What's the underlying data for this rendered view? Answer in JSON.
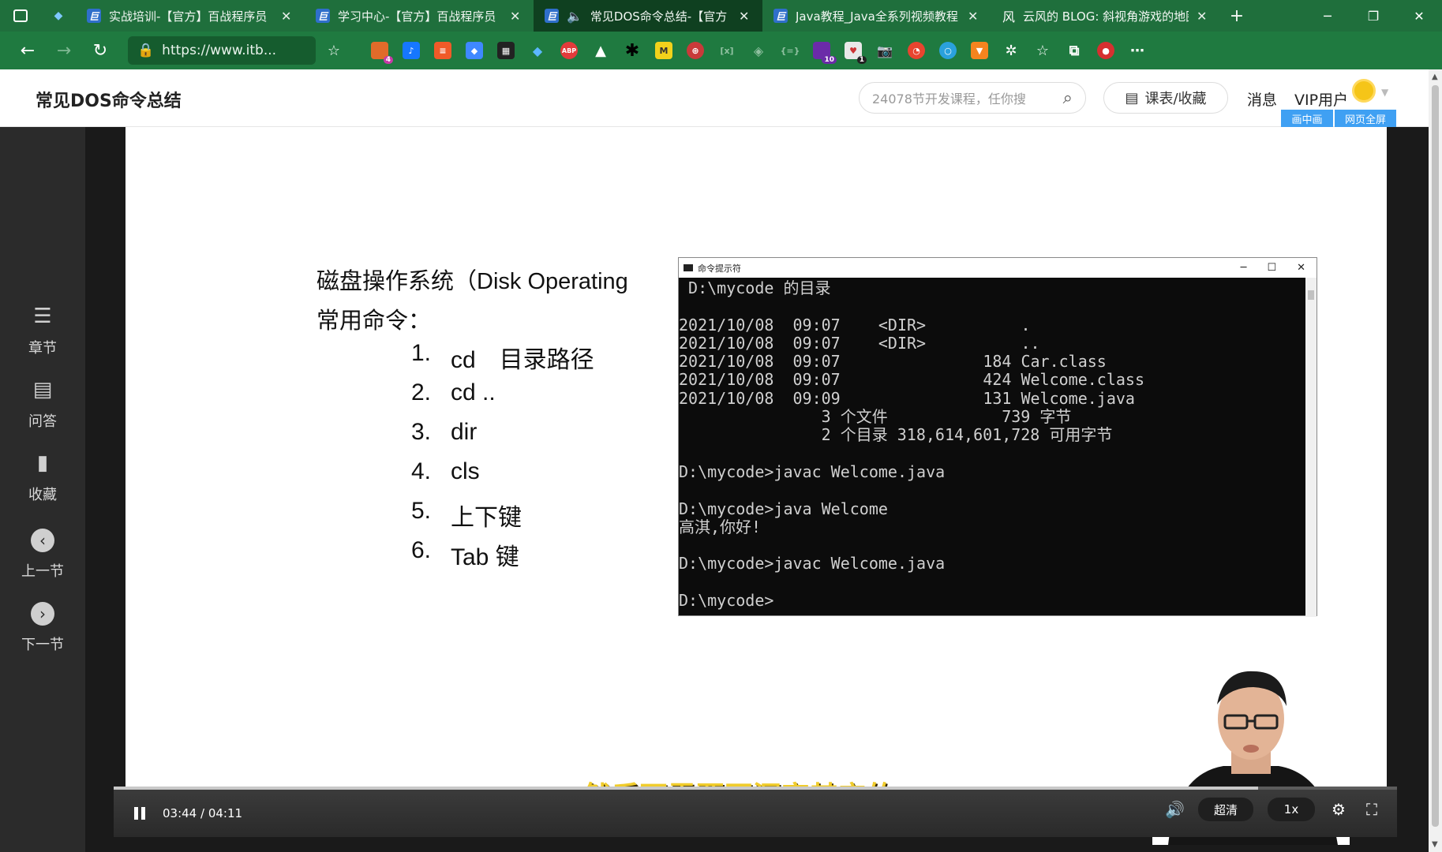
{
  "browser": {
    "tabs": [
      {
        "title": "实战培训-【官方】百战程序员",
        "active": false
      },
      {
        "title": "学习中心-【官方】百战程序员",
        "active": false
      },
      {
        "title": "常见DOS命令总结-【官方",
        "active": true,
        "audio": true
      },
      {
        "title": "Java教程_Java全系列视频教程",
        "active": false
      },
      {
        "title": "云风的 BLOG: 斜视角游戏的地图",
        "active": false
      }
    ],
    "url": "https://www.itb...",
    "extension_badges": {
      "ext1": "4",
      "ext2": "10",
      "ext3": "1"
    },
    "ext_labels": {
      "abp": "ABP",
      "m": "M"
    }
  },
  "header": {
    "title": "常见DOS命令总结",
    "search_placeholder": "24078节开发课程，任你搜",
    "courses_button": "课表/收藏",
    "messages": "消息",
    "vip": "VIP用户",
    "pip_button": "画中画",
    "webfull_button": "网页全屏"
  },
  "sidebar": {
    "items": [
      {
        "label": "章节",
        "icon": "chapters-icon"
      },
      {
        "label": "问答",
        "icon": "qa-icon"
      },
      {
        "label": "收藏",
        "icon": "bookmark-icon"
      },
      {
        "label": "上一节",
        "icon": "prev-icon"
      },
      {
        "label": "下一节",
        "icon": "next-icon"
      }
    ]
  },
  "slide": {
    "heading": "磁盘操作系统（Disk Operating",
    "subheading": "常用命令：",
    "commands": [
      {
        "num": "1.",
        "text": "cd　目录路径"
      },
      {
        "num": "2.",
        "text": "cd .."
      },
      {
        "num": "3.",
        "text": "dir"
      },
      {
        "num": "4.",
        "text": "cls"
      },
      {
        "num": "5.",
        "text": "上下键"
      },
      {
        "num": "6.",
        "text": "Tab 键"
      }
    ]
  },
  "cmd_window": {
    "title": "命令提示符",
    "lines": [
      " D:\\mycode 的目录",
      "",
      "2021/10/08  09:07    <DIR>          .",
      "2021/10/08  09:07    <DIR>          ..",
      "2021/10/08  09:07               184 Car.class",
      "2021/10/08  09:07               424 Welcome.class",
      "2021/10/08  09:09               131 Welcome.java",
      "               3 个文件            739 字节",
      "               2 个目录 318,614,601,728 可用字节",
      "",
      "D:\\mycode>javac Welcome.java",
      "",
      "D:\\mycode>java Welcome",
      "高淇,你好!",
      "",
      "D:\\mycode>javac Welcome.java",
      "",
      "D:\\mycode>"
    ]
  },
  "video": {
    "subtitle": "然后不需要再深究其它的",
    "time": "03:44 / 04:11",
    "progress": 0.892,
    "quality": "超清",
    "speed": "1x"
  },
  "colors": {
    "browser_green": "#1f7a40",
    "tab_active": "#0f4020",
    "subtitle_yellow": "#f0cc2c",
    "badge_blue": "#3fa0f3"
  }
}
